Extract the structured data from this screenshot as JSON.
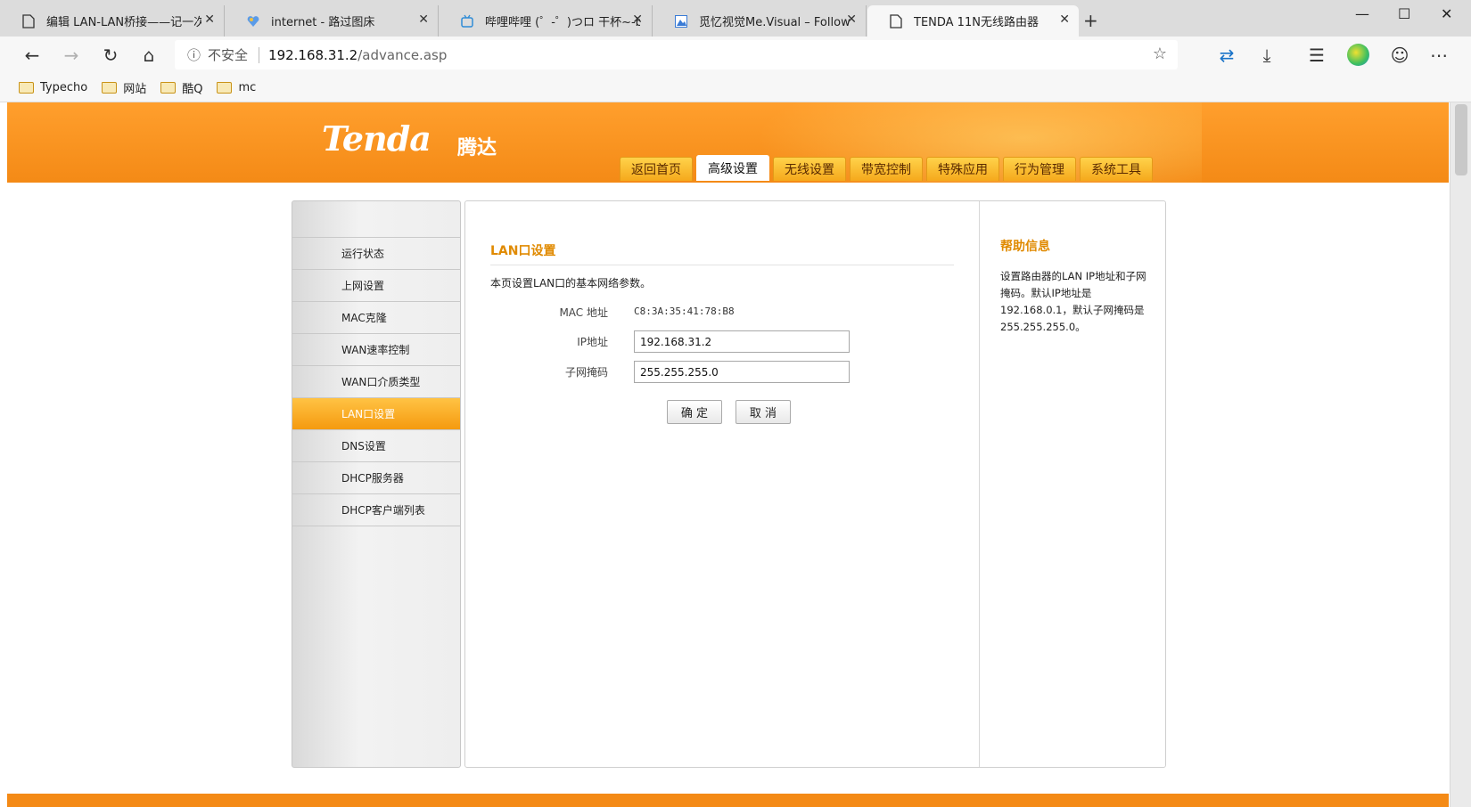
{
  "browser": {
    "tabs": [
      {
        "label": "编辑 LAN-LAN桥接——记一次家",
        "icon": "page-icon"
      },
      {
        "label": "internet - 路过图床",
        "icon": "heart-logo-icon"
      },
      {
        "label": "哔哩哔哩 (゜-゜)つロ 干杯~-bilib",
        "icon": "tv-icon"
      },
      {
        "label": "觅忆视觉Me.Visual – Follow the",
        "icon": "mountain-icon"
      },
      {
        "label": "TENDA 11N无线路由器",
        "icon": "page-icon"
      }
    ],
    "active_tab": 4,
    "address": {
      "security_label": "不安全",
      "host": "192.168.31.2",
      "path": "/advance.asp"
    },
    "bookmarks": [
      "Typecho",
      "网站",
      "酷Q",
      "mc"
    ]
  },
  "router": {
    "logo": "Tenda",
    "logo_cn": "腾达",
    "nav_tabs": [
      "返回首页",
      "高级设置",
      "无线设置",
      "带宽控制",
      "特殊应用",
      "行为管理",
      "系统工具"
    ],
    "active_nav": 1,
    "side_menu": [
      "运行状态",
      "上网设置",
      "MAC克隆",
      "WAN速率控制",
      "WAN口介质类型",
      "LAN口设置",
      "DNS设置",
      "DHCP服务器",
      "DHCP客户端列表"
    ],
    "active_side": 5,
    "section_title": "LAN口设置",
    "section_desc": "本页设置LAN口的基本网络参数。",
    "form": {
      "mac_label": "MAC 地址",
      "mac_value": "C8:3A:35:41:78:B8",
      "ip_label": "IP地址",
      "ip_value": "192.168.31.2",
      "mask_label": "子网掩码",
      "mask_value": "255.255.255.0"
    },
    "buttons": {
      "ok": "确 定",
      "cancel": "取 消"
    },
    "help": {
      "title": "帮助信息",
      "text": "设置路由器的LAN IP地址和子网掩码。默认IP地址是192.168.0.1，默认子网掩码是255.255.255.0。"
    }
  },
  "colors": {
    "brand_orange": "#f48a16",
    "title_orange": "#e08a00"
  }
}
